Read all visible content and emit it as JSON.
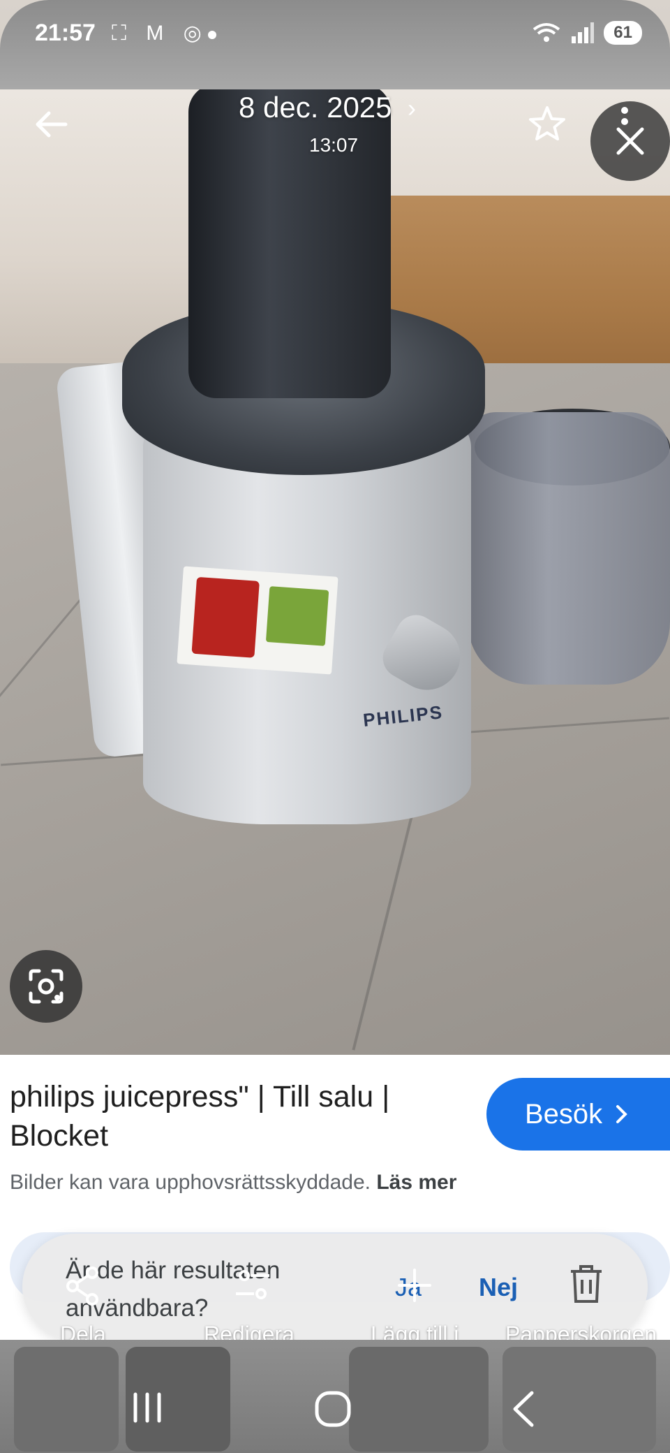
{
  "status": {
    "time": "21:57",
    "notif_icons": "⛶ M ◎",
    "battery": "61"
  },
  "viewer": {
    "date": "8 dec. 2025",
    "time": "13:07"
  },
  "photo": {
    "brand_on_device": "PHILIPS"
  },
  "result": {
    "title": "philips juicepress\" | Till salu | Blocket",
    "visit_label": "Besök",
    "copyright_text": "Bilder kan vara upphovsrättsskyddade.",
    "read_more": "Läs mer"
  },
  "feedback": {
    "question": "Är de här resultaten användbara?",
    "yes": "Ja",
    "no": "Nej"
  },
  "actions": [
    {
      "label": "Dela",
      "icon": "share-icon"
    },
    {
      "label": "Redigera",
      "icon": "edit-sliders-icon"
    },
    {
      "label": "Lägg till i",
      "icon": "add-icon"
    },
    {
      "label": "Papperskorgen",
      "icon": "trash-icon"
    }
  ],
  "colors": {
    "accent": "#1a73e8",
    "link": "#1a5fb4"
  }
}
